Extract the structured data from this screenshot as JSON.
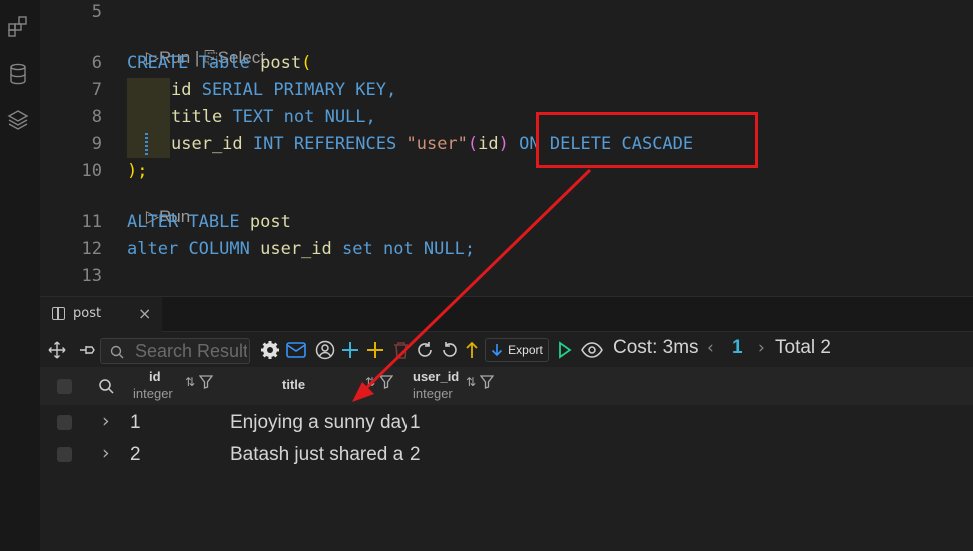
{
  "editor": {
    "lines": [
      {
        "num": "5"
      },
      {
        "num": "6"
      },
      {
        "num": "7"
      },
      {
        "num": "8"
      },
      {
        "num": "9"
      },
      {
        "num": "10"
      },
      {
        "num": "11"
      },
      {
        "num": "12"
      },
      {
        "num": "13"
      }
    ],
    "lens1": {
      "run": "Run",
      "sep": "|",
      "select": "Select"
    },
    "lens2": {
      "run": "Run"
    },
    "code": {
      "l6": {
        "create": "CREATE",
        "table": "Table",
        "name": "post",
        "paren": "("
      },
      "l7": {
        "col": "id",
        "type": "SERIAL",
        "pk": "PRIMARY KEY,"
      },
      "l8": {
        "col": "title",
        "type": "TEXT",
        "nn": "not NULL,"
      },
      "l9": {
        "col": "user_id",
        "type": "INT",
        "refs": "REFERENCES",
        "str": "\"user\"",
        "open": "(",
        "refcol": "id",
        "close": ")",
        "ondel": "ON DELETE CASCADE"
      },
      "l10": {
        "close": ");"
      },
      "l11": {
        "alter": "ALTER",
        "table": "TABLE",
        "name": "post"
      },
      "l12": {
        "alter": "alter",
        "column": "COLUMN",
        "col": "user_id",
        "set": "set",
        "nn": "not NULL;"
      }
    }
  },
  "panel": {
    "tab_label": "post",
    "search_placeholder": "Search Result",
    "export_label": "Export",
    "cost": "Cost: 3ms",
    "page": "1",
    "total": "Total 2",
    "columns": [
      {
        "name": "id",
        "type": "integer"
      },
      {
        "name": "title",
        "type": ""
      },
      {
        "name": "user_id",
        "type": "integer"
      }
    ],
    "rows": [
      {
        "id": "1",
        "title": "Enjoying a sunny day",
        "user_id": "1"
      },
      {
        "id": "2",
        "title": "Batash just shared a",
        "user_id": "2"
      }
    ]
  },
  "colors": {
    "annotation": "#e0191d",
    "keyword": "#569cd6",
    "accent": "#3794ff"
  }
}
